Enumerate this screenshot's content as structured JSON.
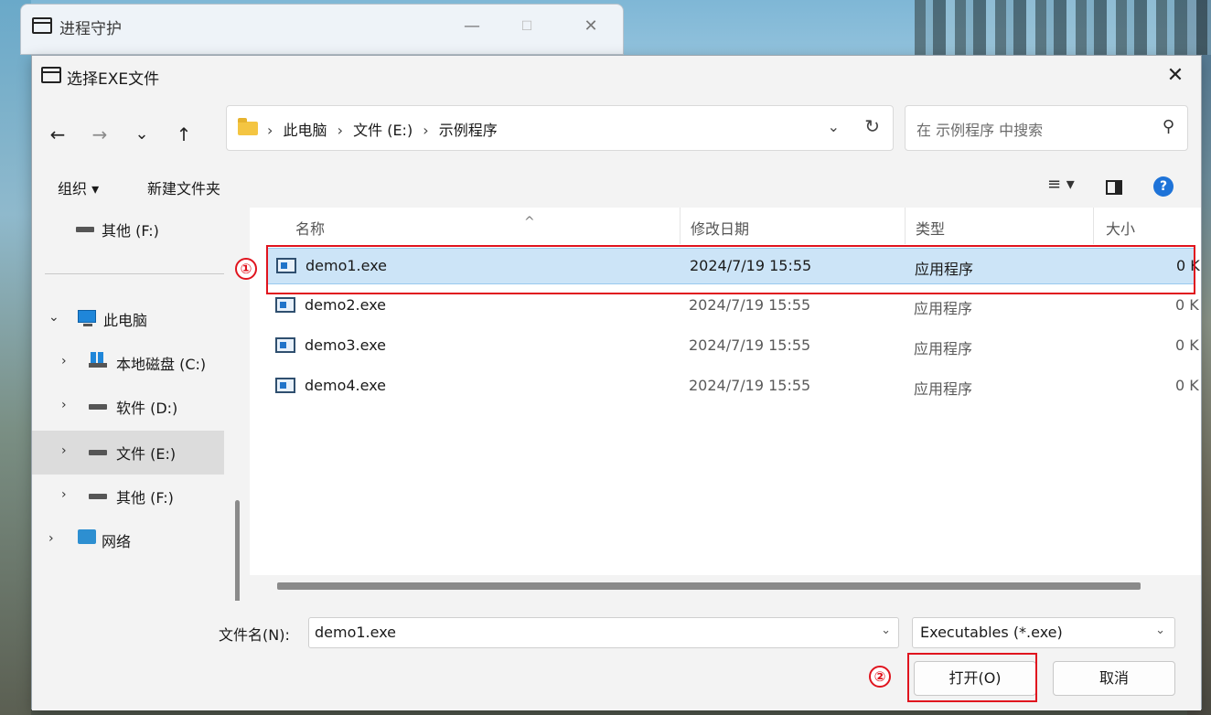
{
  "parent_window": {
    "title": "进程守护",
    "minimize": "—",
    "maximize": "☐",
    "close": "✕"
  },
  "dialog": {
    "title": "选择EXE文件",
    "close": "✕"
  },
  "nav": {
    "back": "←",
    "forward": "→",
    "recent": "⌄",
    "up": "↑",
    "breadcrumbs": [
      "此电脑",
      "文件 (E:)",
      "示例程序"
    ],
    "separator": "›",
    "dropdown": "⌄",
    "refresh": "↻",
    "search_placeholder": "在 示例程序 中搜索",
    "search_icon": "⚲"
  },
  "commands": {
    "organize": "组织 ▾",
    "new_folder": "新建文件夹",
    "view_icon": "≡ ▾"
  },
  "help_label": "?",
  "nav_pane": {
    "items": [
      {
        "label": "其他 (F:)",
        "icon": "drive-icon"
      },
      {
        "label": "此电脑",
        "icon": "pc-icon",
        "chevron": "⌄"
      },
      {
        "label": "本地磁盘 (C:)",
        "icon": "windows-drive-icon",
        "chevron": "›"
      },
      {
        "label": "软件 (D:)",
        "icon": "drive-icon",
        "chevron": "›"
      },
      {
        "label": "文件 (E:)",
        "icon": "drive-icon",
        "chevron": "›",
        "selected": true
      },
      {
        "label": "其他 (F:)",
        "icon": "drive-icon",
        "chevron": "›"
      },
      {
        "label": "网络",
        "icon": "network-icon",
        "chevron": "›"
      }
    ]
  },
  "columns": {
    "name": "名称",
    "date": "修改日期",
    "type": "类型",
    "size": "大小",
    "sort_indicator": "^"
  },
  "files": [
    {
      "name": "demo1.exe",
      "date": "2024/7/19 15:55",
      "type": "应用程序",
      "size": "0 K",
      "selected": true
    },
    {
      "name": "demo2.exe",
      "date": "2024/7/19 15:55",
      "type": "应用程序",
      "size": "0 K"
    },
    {
      "name": "demo3.exe",
      "date": "2024/7/19 15:55",
      "type": "应用程序",
      "size": "0 K"
    },
    {
      "name": "demo4.exe",
      "date": "2024/7/19 15:55",
      "type": "应用程序",
      "size": "0 K"
    }
  ],
  "bottom": {
    "filename_label": "文件名(N):",
    "filename_value": "demo1.exe",
    "filetype_value": "Executables (*.exe)",
    "dropdown": "⌄",
    "open_label": "打开(O)",
    "cancel_label": "取消"
  },
  "annotations": {
    "step1": "①",
    "step2": "②",
    "color": "#e0141e"
  }
}
